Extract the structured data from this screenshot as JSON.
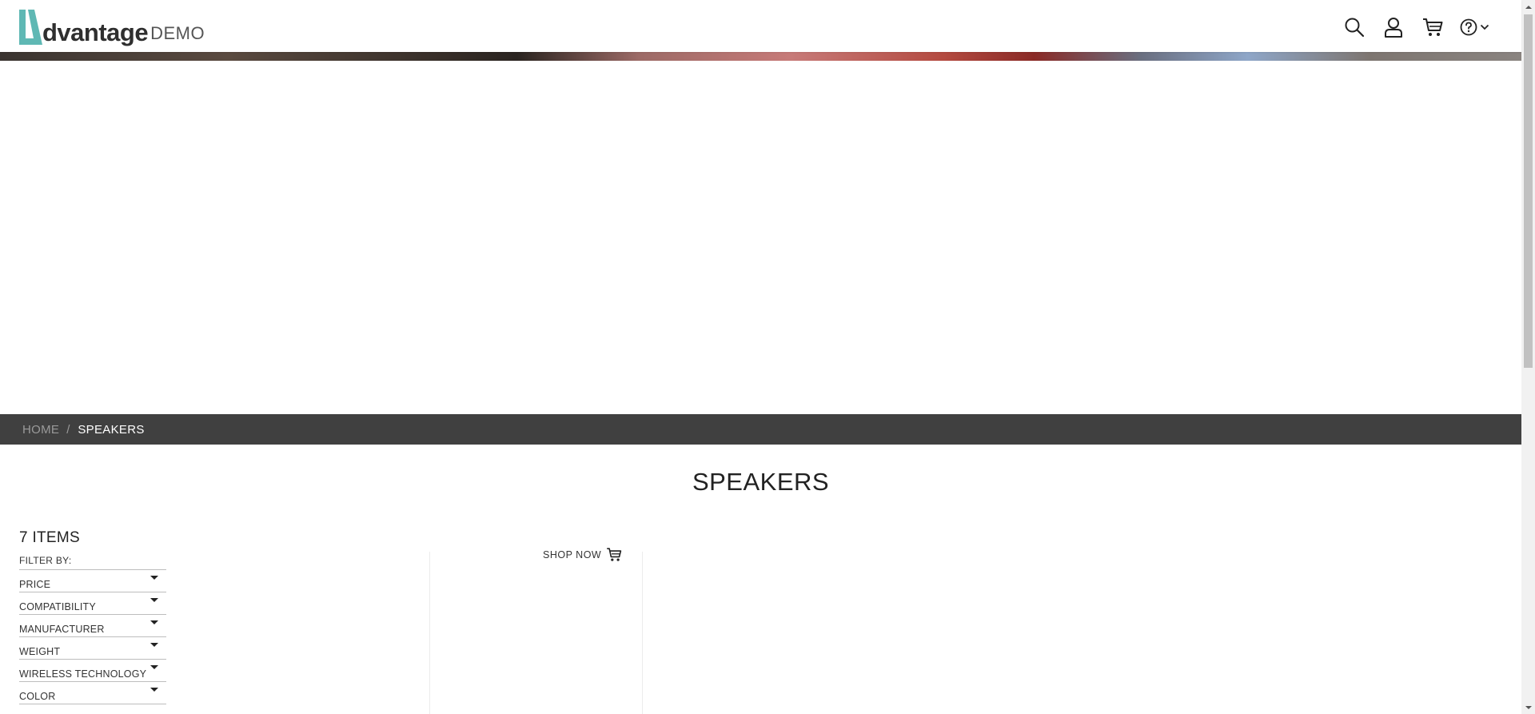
{
  "header": {
    "logo_word": "dvantage",
    "logo_demo": "DEMO",
    "icons": [
      "search-icon",
      "user-icon",
      "cart-icon",
      "help-icon",
      "chevron-down-icon"
    ]
  },
  "breadcrumb": {
    "home": "HOME",
    "separator": "/",
    "current": "SPEAKERS"
  },
  "page_title": "SPEAKERS",
  "filters": {
    "items_count": "7 ITEMS",
    "filter_by": "FILTER BY:",
    "items": [
      "PRICE",
      "COMPATIBILITY",
      "MANUFACTURER",
      "WEIGHT",
      "WIRELESS TECHNOLOGY",
      "COLOR"
    ]
  },
  "product": {
    "shop_now": "SHOP NOW"
  },
  "colors": {
    "brand_teal": "#5fb8b4",
    "breadcrumb_bg": "#404040",
    "text_dark": "#222222"
  }
}
